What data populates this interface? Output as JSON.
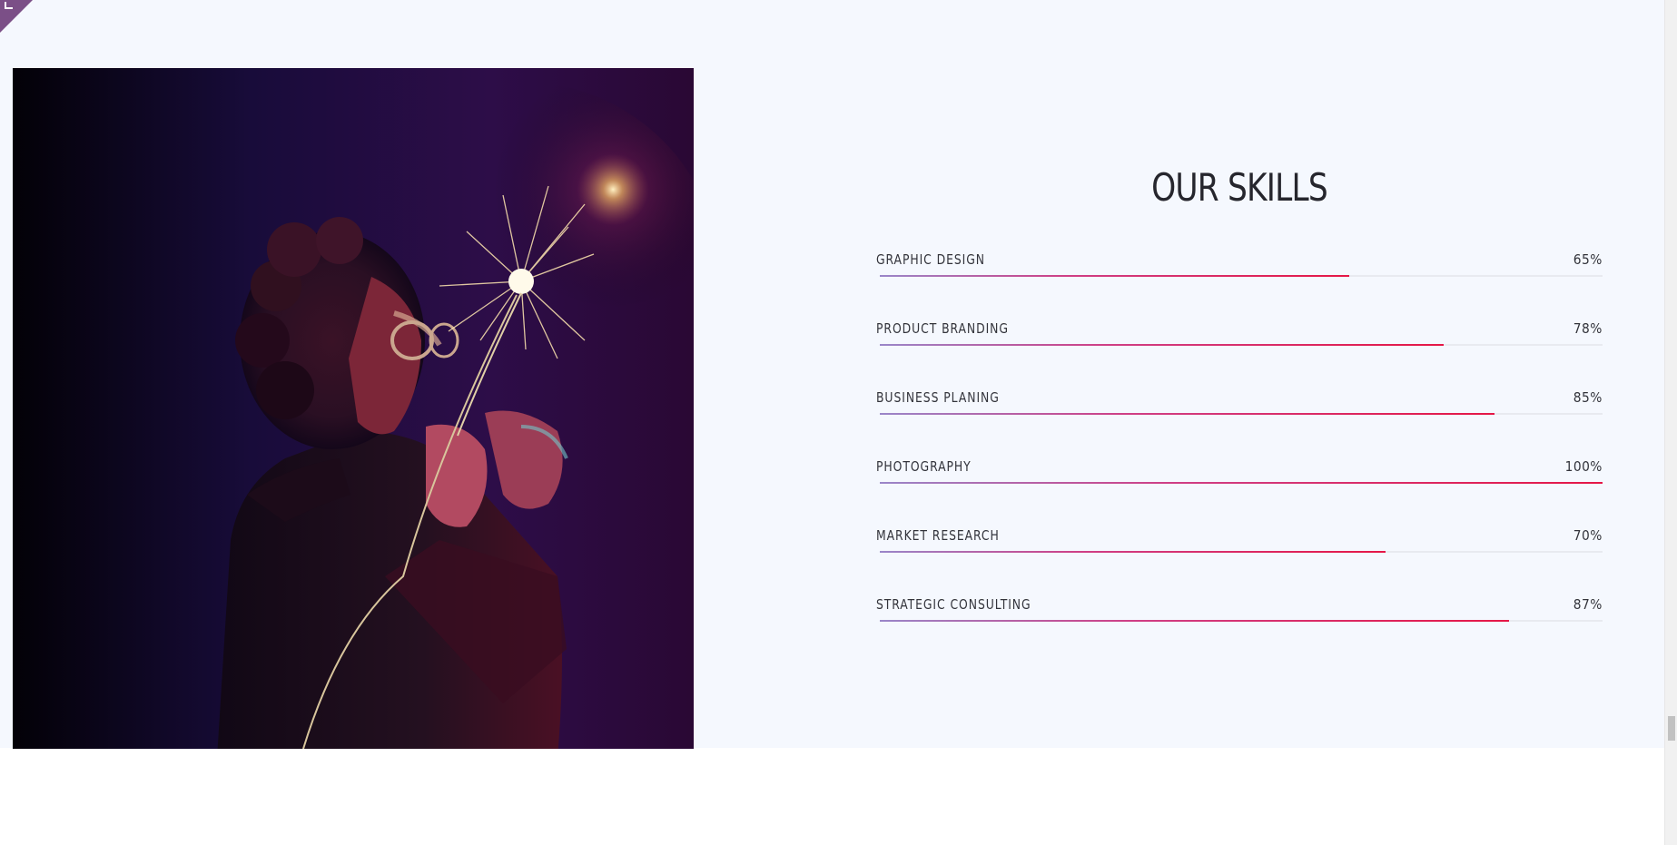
{
  "skills": {
    "title": "OUR SKILLS",
    "items": [
      {
        "label": "GRAPHIC DESIGN",
        "value_text": "65%",
        "value": 65
      },
      {
        "label": "PRODUCT BRANDING",
        "value_text": "78%",
        "value": 78
      },
      {
        "label": "BUSINESS PLANING",
        "value_text": "85%",
        "value": 85
      },
      {
        "label": "PHOTOGRAPHY",
        "value_text": "100%",
        "value": 100
      },
      {
        "label": "MARKET RESEARCH",
        "value_text": "70%",
        "value": 70
      },
      {
        "label": "STRATEGIC CONSULTING",
        "value_text": "87%",
        "value": 87
      }
    ]
  },
  "colors": {
    "section_bg": "#f5f8fe",
    "accent": "#e51747",
    "accent_start": "#9a86c9",
    "corner_tab": "#7b4f87",
    "text": "#26262d"
  },
  "icons": {
    "corner": "corner-bracket-icon",
    "photo": "person-with-sparkler-photo"
  }
}
